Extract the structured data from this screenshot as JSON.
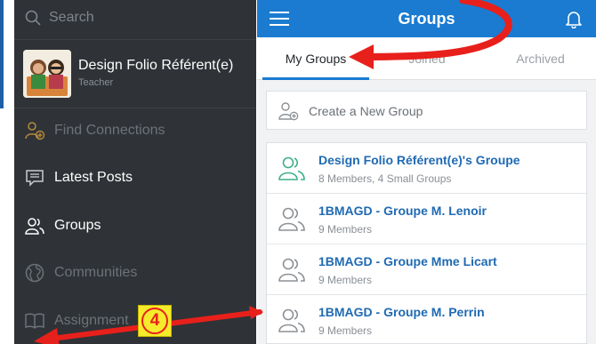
{
  "sidebar": {
    "search_placeholder": "Search",
    "profile": {
      "name": "Design Folio Référent(e)",
      "role": "Teacher"
    },
    "items": [
      {
        "label": "Find Connections",
        "icon": "add-person-icon",
        "active": false
      },
      {
        "label": "Latest Posts",
        "icon": "posts-icon",
        "active": true
      },
      {
        "label": "Groups",
        "icon": "groups-icon",
        "active": true
      },
      {
        "label": "Communities",
        "icon": "globe-icon",
        "active": false
      },
      {
        "label": "Assignment",
        "icon": "book-icon",
        "active": false
      }
    ]
  },
  "header": {
    "title": "Groups",
    "menu_icon": "hamburger-icon",
    "notifications_icon": "bell-icon"
  },
  "tabs": [
    {
      "label": "My Groups",
      "active": true
    },
    {
      "label": "Joined",
      "active": false
    },
    {
      "label": "Archived",
      "active": false
    }
  ],
  "create_group": {
    "label": "Create a New Group"
  },
  "groups": [
    {
      "name": "Design Folio Référent(e)'s Groupe",
      "meta": "8 Members, 4 Small Groups",
      "icon_color": "#3fae8a"
    },
    {
      "name": "1BMAGD - Groupe M. Lenoir",
      "meta": "9 Members",
      "icon_color": "#8c9196"
    },
    {
      "name": "1BMAGD - Groupe Mme Licart",
      "meta": "9 Members",
      "icon_color": "#8c9196"
    },
    {
      "name": "1BMAGD - Groupe M. Perrin",
      "meta": "9 Members",
      "icon_color": "#8c9196"
    }
  ],
  "annotation": {
    "step_number": "4"
  },
  "colors": {
    "accent": "#1a7bd1",
    "sidebar_bg": "#2f3337",
    "annotation_arrow": "#e8201b",
    "badge_bg": "#f6ea2d"
  }
}
